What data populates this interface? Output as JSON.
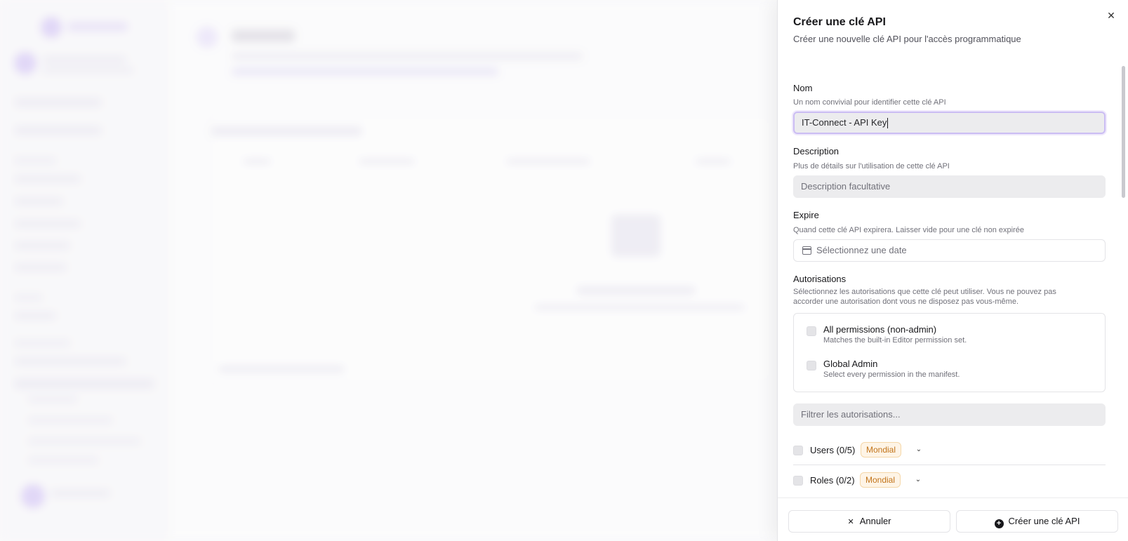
{
  "drawer": {
    "title": "Créer une clé API",
    "subtitle": "Créer une nouvelle clé API pour l'accès programmatique",
    "close_icon": "close-icon"
  },
  "form": {
    "name": {
      "label": "Nom",
      "hint": "Un nom convivial pour identifier cette clé API",
      "value": "IT-Connect - API Key"
    },
    "description": {
      "label": "Description",
      "hint": "Plus de détails sur l'utilisation de cette clé API",
      "placeholder": "Description facultative"
    },
    "expires": {
      "label": "Expire",
      "hint": "Quand cette clé API expirera. Laisser vide pour une clé non expirée",
      "placeholder": "Sélectionnez une date"
    },
    "permissions": {
      "label": "Autorisations",
      "hint_line1": "Sélectionnez les autorisations que cette clé peut utiliser. Vous ne pouvez pas",
      "hint_line2": "accorder une autorisation dont vous ne disposez pas vous-même.",
      "presets": [
        {
          "name": "All permissions (non-admin)",
          "description": "Matches the built-in Editor permission set.",
          "checked": false
        },
        {
          "name": "Global Admin",
          "description": "Select every permission in the manifest.",
          "checked": false
        }
      ],
      "filter_placeholder": "Filtrer les autorisations...",
      "groups": [
        {
          "label": "Users (0/5)",
          "badge": "Mondial",
          "checked": false
        },
        {
          "label": "Roles (0/2)",
          "badge": "Mondial",
          "checked": false
        }
      ]
    }
  },
  "footer": {
    "cancel_label": "Annuler",
    "create_label": "Créer une clé API"
  },
  "colors": {
    "focus_ring": "#cbbdf3",
    "badge_text": "#c2741a",
    "badge_bg": "#fef4e6"
  }
}
